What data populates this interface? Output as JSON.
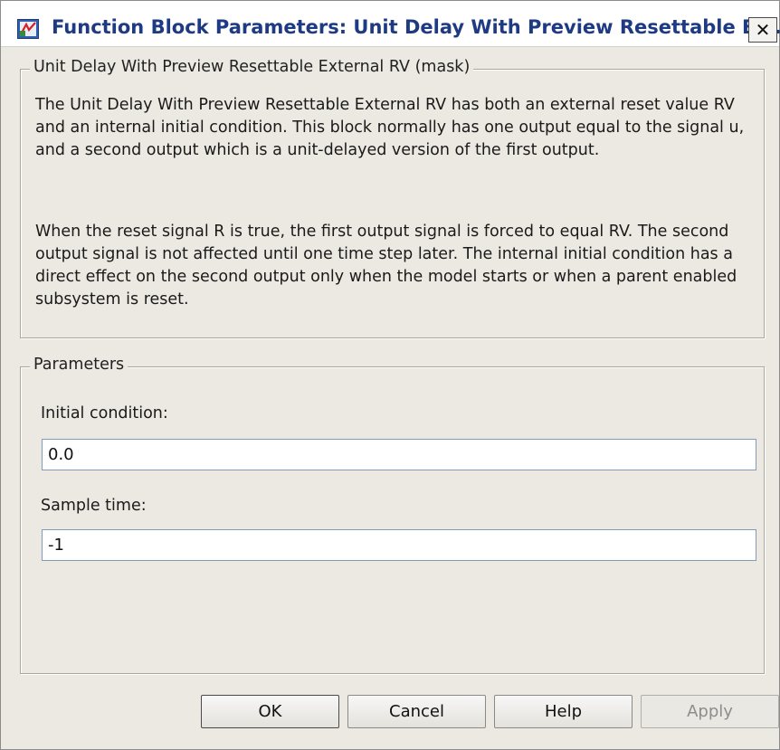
{
  "window": {
    "title": "Function Block Parameters: Unit Delay With Preview Resettable Ex...",
    "close_glyph": "✕"
  },
  "mask_group": {
    "title": "Unit Delay With Preview Resettable External RV (mask)",
    "paragraph1": "The Unit Delay With Preview Resettable External RV has both an external reset value RV and an internal initial condition.  This block normally has one output equal to the signal u, and a second output which is a unit-delayed version of the first output.",
    "paragraph2": "When the reset signal R is true, the first output signal is forced to equal RV. The second output signal is not affected until one time step later. The internal initial condition has a direct effect on the second output only when the model starts or when a parent enabled subsystem is reset."
  },
  "parameters_group": {
    "title": "Parameters",
    "initial_condition": {
      "label": "Initial condition:",
      "value": "0.0"
    },
    "sample_time": {
      "label": "Sample time:",
      "value": "-1"
    }
  },
  "buttons": {
    "ok": "OK",
    "cancel": "Cancel",
    "help": "Help",
    "apply": "Apply"
  },
  "icons": {
    "app": "simulink-block-icon",
    "close": "close-icon"
  },
  "colors": {
    "title_text": "#1e3a82",
    "dialog_bg": "#ece9e2",
    "input_border": "#7f9db9",
    "disabled_text": "#8d8d8d"
  }
}
